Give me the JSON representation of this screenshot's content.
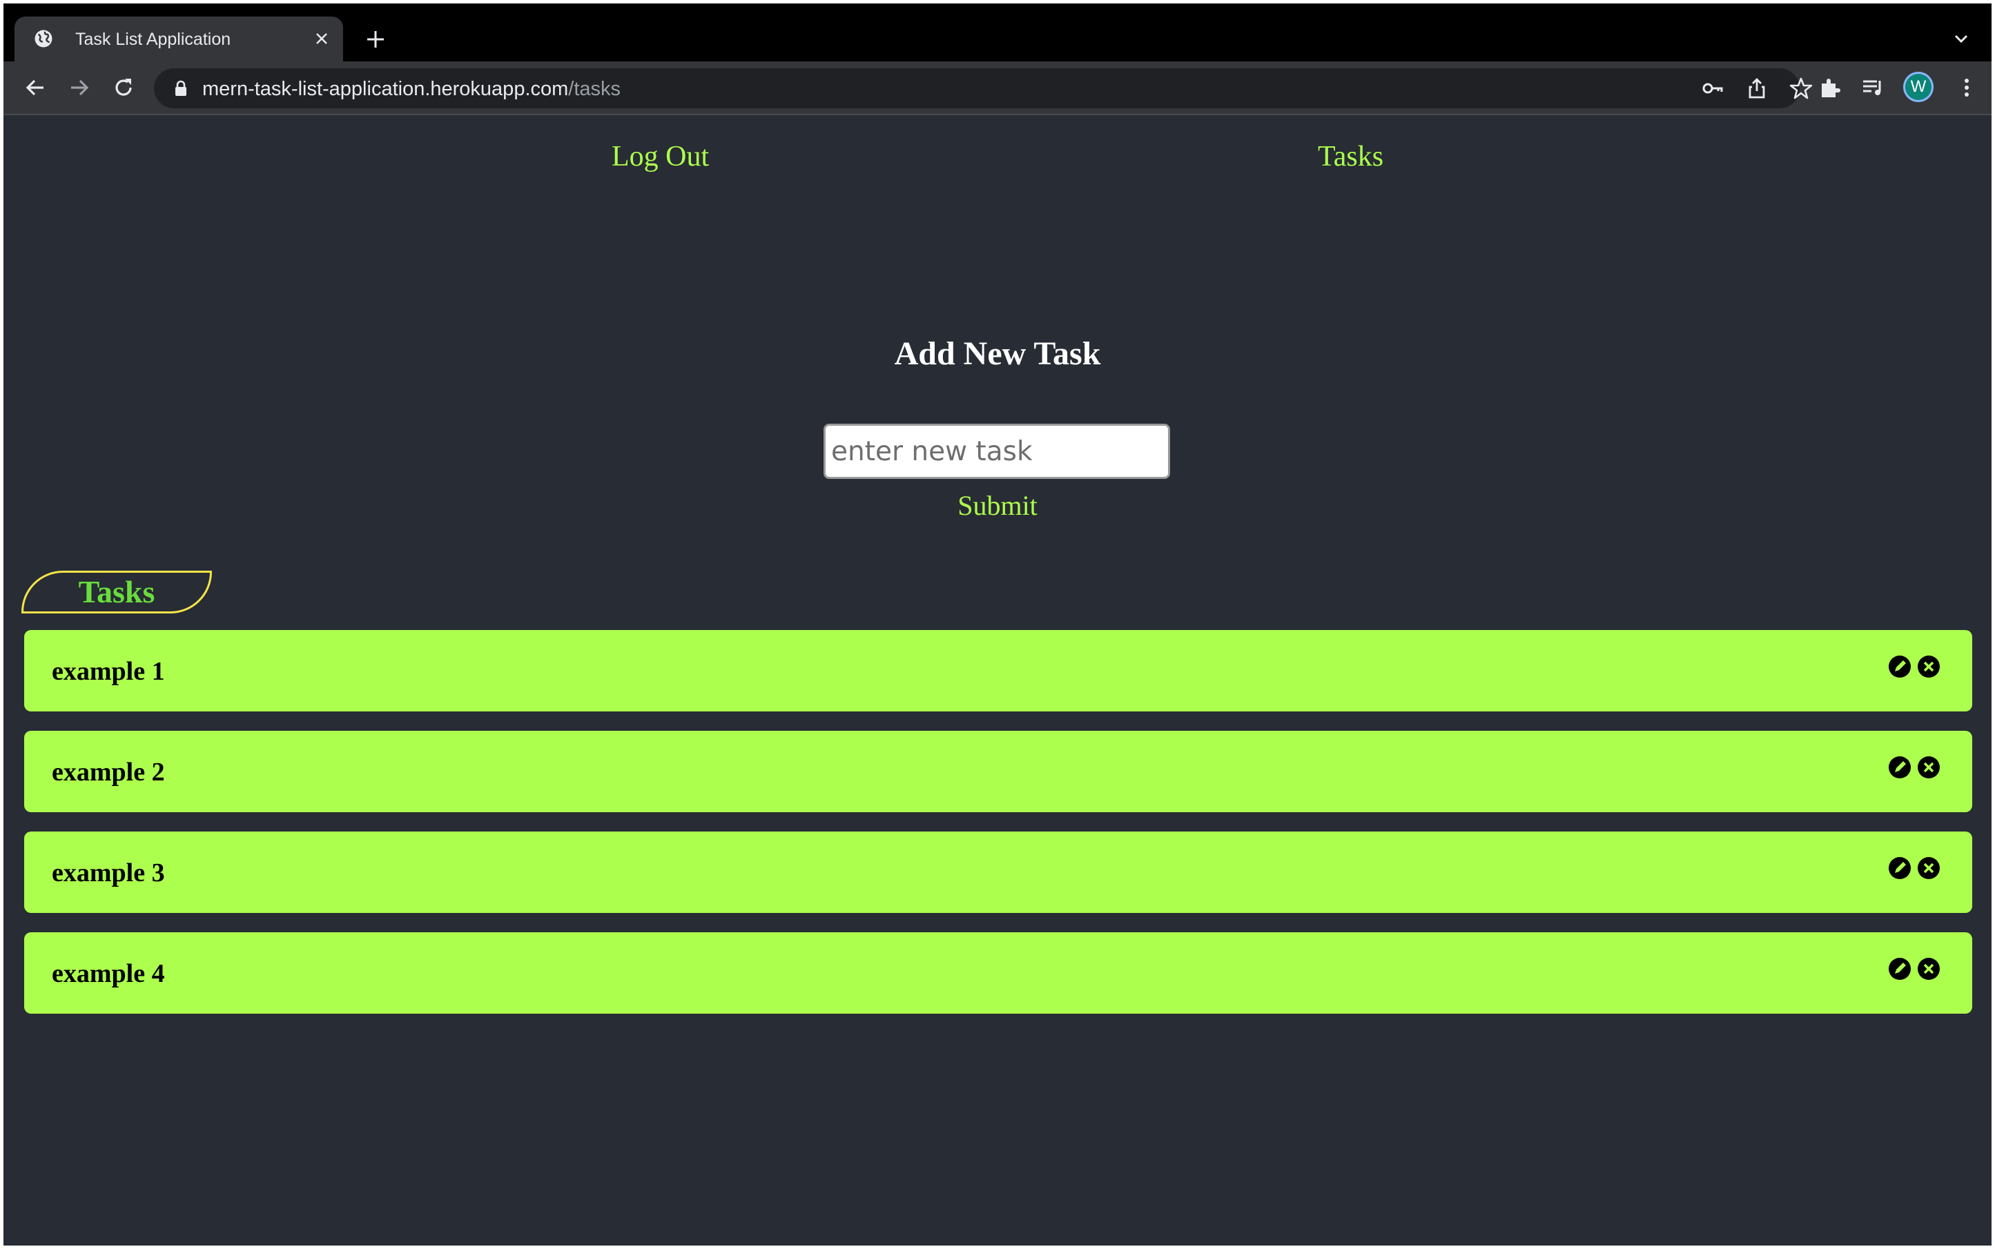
{
  "browser": {
    "tab_title": "Task List Application",
    "url_host": "mern-task-list-application.herokuapp.com",
    "url_path": "/tasks",
    "profile_initial": "W"
  },
  "nav": {
    "logout": "Log Out",
    "tasks": "Tasks"
  },
  "form": {
    "heading": "Add New Task",
    "placeholder": "enter new task",
    "submit": "Submit"
  },
  "list": {
    "title": "Tasks",
    "items": [
      {
        "text": "example 1"
      },
      {
        "text": "example 2"
      },
      {
        "text": "example 3"
      },
      {
        "text": "example 4"
      }
    ]
  },
  "colors": {
    "background": "#282c34",
    "accent": "#adff4d",
    "badge_border": "#f4e44a",
    "badge_text": "#69dd3c"
  }
}
